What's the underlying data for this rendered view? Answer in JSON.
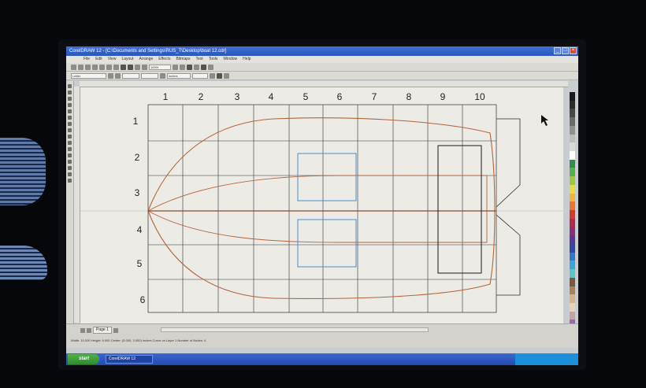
{
  "window": {
    "title": "CorelDRAW 12 - [C:\\Documents and Settings\\RUS_T\\Desktop\\boat 12.cdr]",
    "controls": [
      "_",
      "□",
      "×"
    ]
  },
  "menu": [
    "File",
    "Edit",
    "View",
    "Layout",
    "Arrange",
    "Effects",
    "Bitmaps",
    "Text",
    "Tools",
    "Window",
    "Help"
  ],
  "toolbar": {
    "zoom_value": "100%",
    "paper_value": "Letter",
    "units_value": "inches"
  },
  "grid": {
    "column_labels": [
      "1",
      "2",
      "3",
      "4",
      "5",
      "6",
      "7",
      "8",
      "9",
      "10"
    ],
    "row_labels": [
      "1",
      "2",
      "3",
      "4",
      "5",
      "6"
    ]
  },
  "drawing": {
    "hull_outline_color": "#b5643c",
    "grid_line_color": "#2e2e2e",
    "seat_color": "#4b8cc9",
    "transom_color": "#1a1a1a"
  },
  "page_tabs": {
    "page_label": "Page 1"
  },
  "status_bar": {
    "text": "Width: 10.000  Height: 6.000  Center: (5.000, 3.000) inches   Curve on Layer 1   Number of Nodes: 4"
  },
  "taskbar": {
    "start_label": "start",
    "task_item_label": "CorelDRAW 12",
    "tray_text": ""
  },
  "palette_colors": [
    "#1a1a1a",
    "#2b2b2b",
    "#464646",
    "#6a6a6a",
    "#909090",
    "#bcbcbc",
    "#d8d8d8",
    "#ffffff",
    "#2f8f4a",
    "#57b04a",
    "#9cc940",
    "#e8dd3c",
    "#f2b43a",
    "#e9772f",
    "#d8392c",
    "#b3294a",
    "#8c2f7a",
    "#5c3696",
    "#2f4aa5",
    "#2f7ac8",
    "#37a6d9",
    "#58c7c6",
    "#7a5a3a",
    "#a8825a",
    "#d6b48a",
    "#e6d3b3",
    "#c7a0a8",
    "#9a6aa4"
  ]
}
